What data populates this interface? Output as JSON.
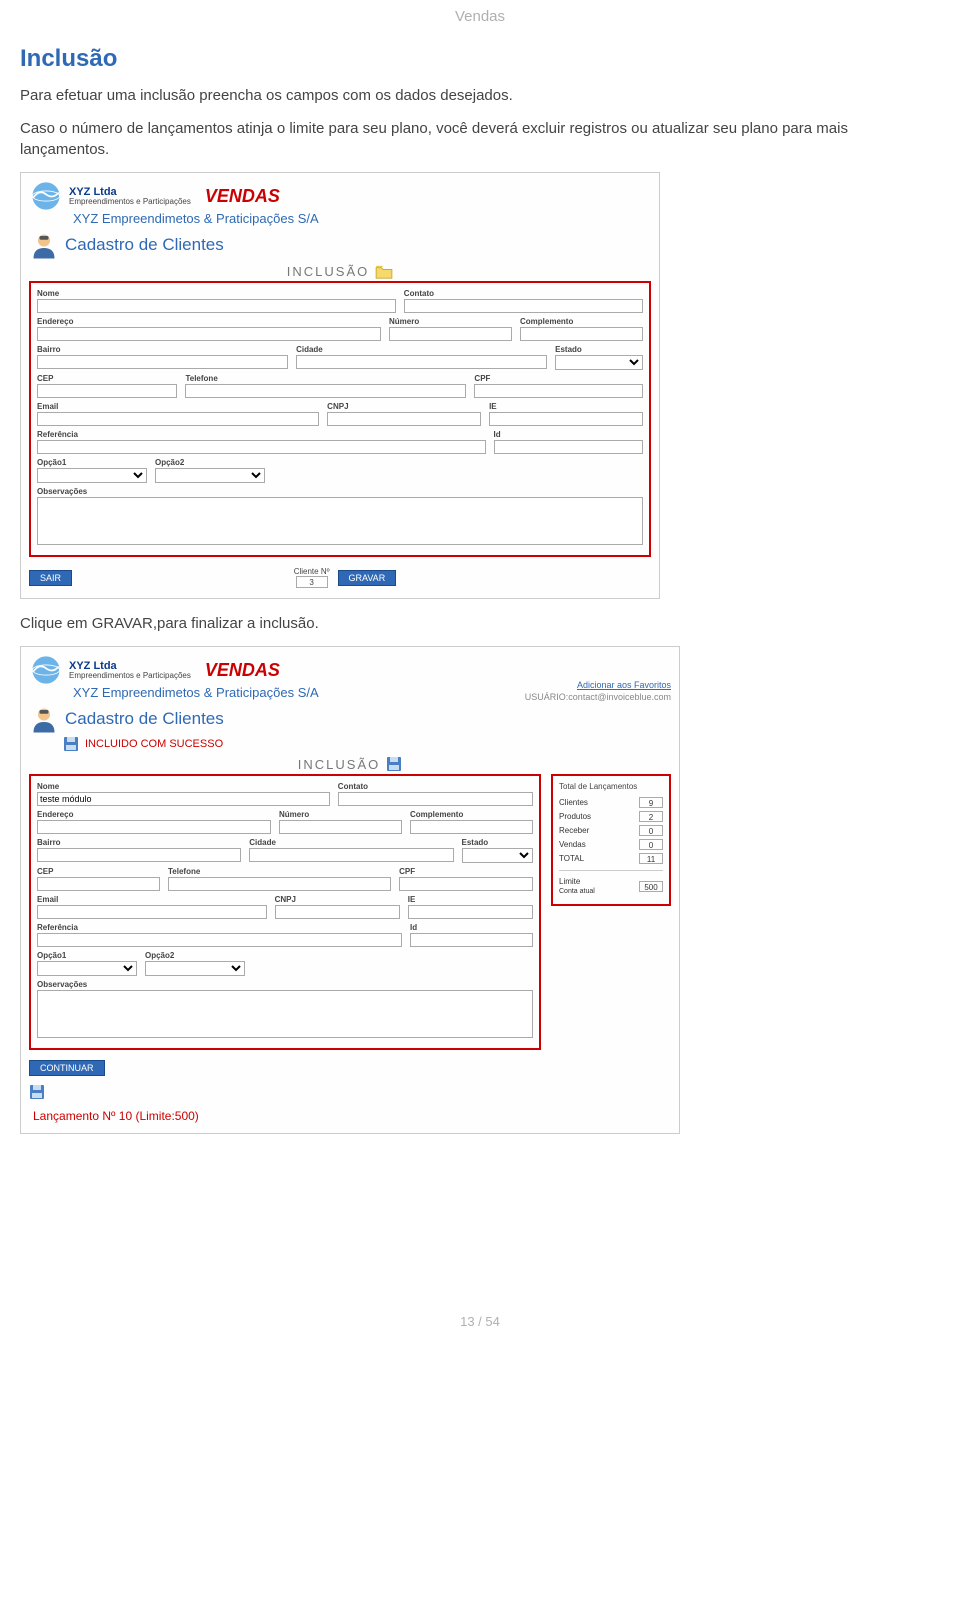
{
  "page": {
    "header": "Vendas",
    "footer": "13 / 54"
  },
  "section": {
    "title": "Inclusão",
    "p1": "Para efetuar uma inclusão preencha os campos com os dados desejados.",
    "p2": "Caso o número de lançamentos atinja o limite para seu plano, você deverá excluir registros ou atualizar seu plano para mais lançamentos.",
    "p3": "Clique em GRAVAR,para finalizar a inclusão."
  },
  "app": {
    "brand": "XYZ Ltda",
    "subbrand": "Empreendimentos e Participações",
    "vendas_logo": "VENDAS",
    "company_line": "XYZ Empreendimetos & Praticipações S/A",
    "cadastro_title": "Cadastro de Clientes",
    "inclusao_label": "INCLUSÃO",
    "success_msg": "INCLUIDO COM SUCESSO",
    "fav_link": "Adicionar aos Favoritos",
    "user_line": "USUÁRIO:contact@invoiceblue.com",
    "lanc_note": "Lançamento Nº 10 (Limite:500)"
  },
  "form": {
    "labels": {
      "nome": "Nome",
      "contato": "Contato",
      "endereco": "Endereço",
      "numero": "Número",
      "complemento": "Complemento",
      "bairro": "Bairro",
      "cidade": "Cidade",
      "estado": "Estado",
      "cep": "CEP",
      "telefone": "Telefone",
      "cpf": "CPF",
      "email": "Email",
      "cnpj": "CNPJ",
      "ie": "IE",
      "referencia": "Referência",
      "id": "Id",
      "opcao1": "Opção1",
      "opcao2": "Opção2",
      "observacoes": "Observações"
    },
    "values": {
      "nome2": "teste módulo"
    },
    "buttons": {
      "sair": "SAIR",
      "gravar": "GRAVAR",
      "continuar": "CONTINUAR"
    },
    "cliente_n_label": "Cliente Nº",
    "cliente_n_value": "3"
  },
  "side": {
    "title": "Total de Lançamentos",
    "items": [
      {
        "label": "Clientes",
        "value": "9"
      },
      {
        "label": "Produtos",
        "value": "2"
      },
      {
        "label": "Receber",
        "value": "0"
      },
      {
        "label": "Vendas",
        "value": "0"
      }
    ],
    "total_label": "TOTAL",
    "total_value": "11",
    "limit_label": "Limite",
    "limit_sub": "Conta atual",
    "limit_value": "500"
  }
}
